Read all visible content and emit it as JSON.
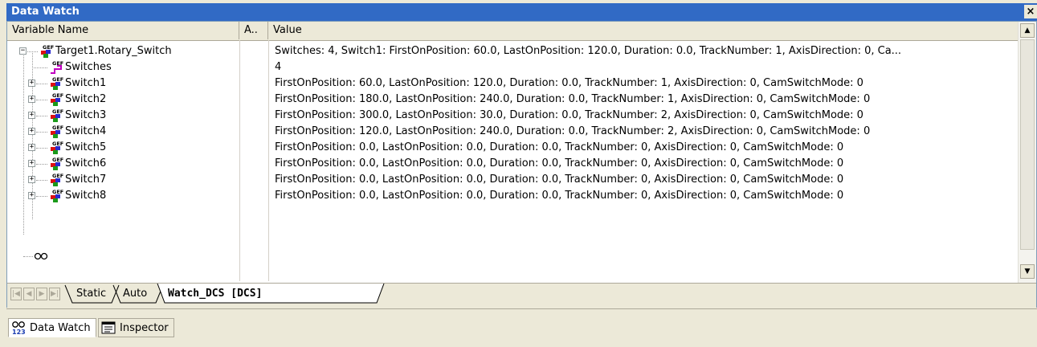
{
  "window": {
    "title": "Data Watch",
    "close_glyph": "×"
  },
  "columns": {
    "name": "Variable Name",
    "address": "A..",
    "value": "Value"
  },
  "rows": [
    {
      "name": "Target1.Rotary_Switch",
      "value": "Switches: 4, Switch1: FirstOnPosition: 60.0, LastOnPosition: 120.0, Duration: 0.0, TrackNumber: 1, AxisDirection: 0, Ca...",
      "expander": "−",
      "icon": "structure-icon"
    },
    {
      "name": "Switches",
      "value": "4",
      "icon": "variable-icon"
    },
    {
      "name": "Switch1",
      "value": "FirstOnPosition: 60.0, LastOnPosition: 120.0, Duration: 0.0, TrackNumber: 1, AxisDirection: 0, CamSwitchMode: 0",
      "expander": "+",
      "icon": "structure-icon"
    },
    {
      "name": "Switch2",
      "value": "FirstOnPosition: 180.0, LastOnPosition: 240.0, Duration: 0.0, TrackNumber: 1, AxisDirection: 0, CamSwitchMode: 0",
      "expander": "+",
      "icon": "structure-icon"
    },
    {
      "name": "Switch3",
      "value": "FirstOnPosition: 300.0, LastOnPosition: 30.0, Duration: 0.0, TrackNumber: 2, AxisDirection: 0, CamSwitchMode: 0",
      "expander": "+",
      "icon": "structure-icon"
    },
    {
      "name": "Switch4",
      "value": "FirstOnPosition: 120.0, LastOnPosition: 240.0, Duration: 0.0, TrackNumber: 2, AxisDirection: 0, CamSwitchMode: 0",
      "expander": "+",
      "icon": "structure-icon"
    },
    {
      "name": "Switch5",
      "value": "FirstOnPosition: 0.0, LastOnPosition: 0.0, Duration: 0.0, TrackNumber: 0, AxisDirection: 0, CamSwitchMode: 0",
      "expander": "+",
      "icon": "structure-icon"
    },
    {
      "name": "Switch6",
      "value": "FirstOnPosition: 0.0, LastOnPosition: 0.0, Duration: 0.0, TrackNumber: 0, AxisDirection: 0, CamSwitchMode: 0",
      "expander": "+",
      "icon": "structure-icon"
    },
    {
      "name": "Switch7",
      "value": "FirstOnPosition: 0.0, LastOnPosition: 0.0, Duration: 0.0, TrackNumber: 0, AxisDirection: 0, CamSwitchMode: 0",
      "expander": "+",
      "icon": "structure-icon"
    },
    {
      "name": "Switch8",
      "value": "FirstOnPosition: 0.0, LastOnPosition: 0.0, Duration: 0.0, TrackNumber: 0, AxisDirection: 0, CamSwitchMode: 0",
      "expander": "+",
      "icon": "structure-icon"
    }
  ],
  "sheet_tabs": [
    "Static",
    "Auto",
    "Watch_DCS [DCS]"
  ],
  "bottom_tabs": [
    {
      "label": "Data Watch",
      "icon": "data-watch-icon"
    },
    {
      "label": "Inspector",
      "icon": "inspector-icon"
    }
  ],
  "colors": {
    "title_bar": "#316ac5",
    "chrome": "#ece9d8",
    "grid_border": "#7f9db9"
  }
}
